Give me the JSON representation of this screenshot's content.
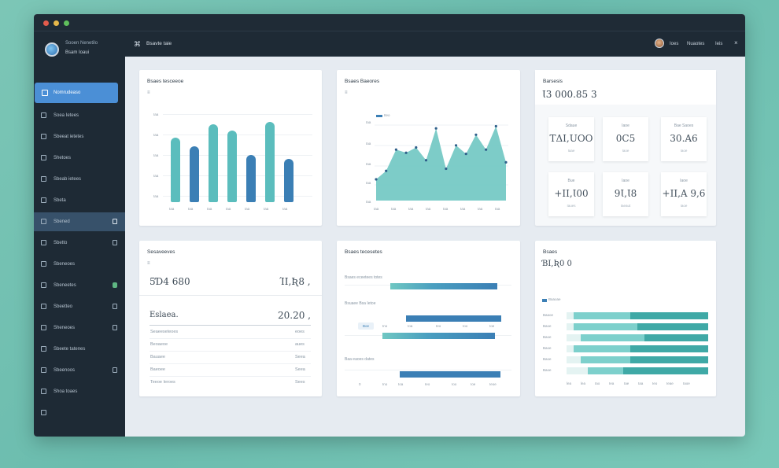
{
  "app": {
    "brand_line1": "Sooen Nenetilo",
    "brand_line2": "Bsam Ioaui",
    "top_title": "Bsavte taie"
  },
  "nav": [
    {
      "label": "Nomrudeaso",
      "active": true
    },
    {
      "label": "Soea Ietees"
    },
    {
      "label": "Sbeeat ietetes"
    },
    {
      "label": "Shetoes"
    },
    {
      "label": "Sbeab ietees"
    },
    {
      "label": "Sbeta"
    },
    {
      "label": "Sbened",
      "selected": true
    },
    {
      "label": "Sbetto"
    },
    {
      "label": "Sbeneoes"
    },
    {
      "label": "Sbeneetes"
    },
    {
      "label": "Sbeetteo"
    },
    {
      "label": "Sheneoes"
    },
    {
      "label": "Sbeete tatenes"
    },
    {
      "label": "Sbeenoos"
    },
    {
      "label": "Shoa toaes"
    }
  ],
  "topbar": {
    "links": [
      "Ioes",
      "Nuaotes",
      "Ieis"
    ],
    "close": "×"
  },
  "bar_card": {
    "title": "Bsaes tesceeoe",
    "subtitle": "≡"
  },
  "area_card": {
    "title": "Bsaes Baeores",
    "subtitle": "≡",
    "legend": "Iteo"
  },
  "kpi_card": {
    "title": "Barsesis",
    "value": "Ɩ3 000.85 3",
    "tiles": [
      {
        "label": "Sdaue",
        "value": "TΔΙ,UOO",
        "foot": "Iaae"
      },
      {
        "label": "Iaoe",
        "value": "0C5",
        "foot": "Iaoe"
      },
      {
        "label": "Bae Saoes",
        "value": "30.A6",
        "foot": "Iaoe"
      },
      {
        "label": "Bue",
        "value": "+ΙΙ,Ɩ00",
        "foot": "Iaues"
      },
      {
        "label": "Iaoe",
        "value": "9Ɩ,Ɩ8",
        "foot": "Iaeaut"
      },
      {
        "label": "Iaoe",
        "value": "+ΙΙ,A 9,6",
        "foot": "Iaoe"
      }
    ]
  },
  "stats_card": {
    "title": "Sesaveeves",
    "row1_left": "5Ɗ4 680",
    "row1_right": "ΊΙ,Ʀ8 ,",
    "row2_left": "Eslaea.",
    "row2_right": "20.20 ,",
    "list": [
      {
        "label": "Seaeeseteoes",
        "value": "eoes"
      },
      {
        "label": "Beoaeoe",
        "value": "aues"
      },
      {
        "label": "Bauaee",
        "value": "Seea"
      },
      {
        "label": "Baeoee",
        "value": "Seea"
      },
      {
        "label": "Teeoe Ieroes",
        "value": "Sees"
      }
    ]
  },
  "hbar_card": {
    "title": "Bsaes tecesetes",
    "groups": [
      {
        "label": "Bsaes eceetees totes"
      },
      {
        "label": "Bsuaee Bsa Ietoe",
        "tag": "Boe"
      },
      {
        "label": "Baa eaoes dates"
      }
    ],
    "ticks": [
      "0",
      "Ino",
      "Ioa",
      "Ieo",
      "Ioo",
      "Ioe",
      "Ieoe"
    ],
    "chart_data": {
      "type": "bar",
      "orientation": "horizontal",
      "values": [
        62,
        55,
        65,
        58
      ]
    }
  },
  "stack_card": {
    "title": "Bsaes",
    "value": "ƁΙ,Ʀ0 0",
    "legend": "Baaoae",
    "row_labels": [
      "Baaoe",
      "Baoe",
      "Baoe",
      "Baoe",
      "Baoe",
      "Baoe"
    ],
    "ticks": [
      "lea",
      "lea",
      "Iao",
      "Iea",
      "Iae",
      "Iaa",
      "Ieo",
      "Ieae",
      "Iaoe"
    ],
    "chart_data": {
      "type": "bar",
      "orientation": "horizontal",
      "stacked": true,
      "values": [
        [
          5,
          40,
          55
        ],
        [
          5,
          45,
          50
        ],
        [
          10,
          45,
          45
        ],
        [
          5,
          40,
          55
        ],
        [
          10,
          35,
          55
        ],
        [
          15,
          25,
          60
        ]
      ]
    }
  },
  "chart_data": [
    {
      "type": "bar",
      "values": [
        60,
        52,
        72,
        66,
        44,
        74,
        40
      ]
    },
    {
      "type": "area",
      "values": [
        20,
        28,
        48,
        45,
        50,
        38,
        68,
        30,
        52,
        44,
        62,
        48,
        70,
        36
      ]
    }
  ],
  "colors": {
    "sidebar": "#1e2a35",
    "accent": "#4b8fd6",
    "teal": "#6fc7c2",
    "blue": "#3b7fb5"
  }
}
